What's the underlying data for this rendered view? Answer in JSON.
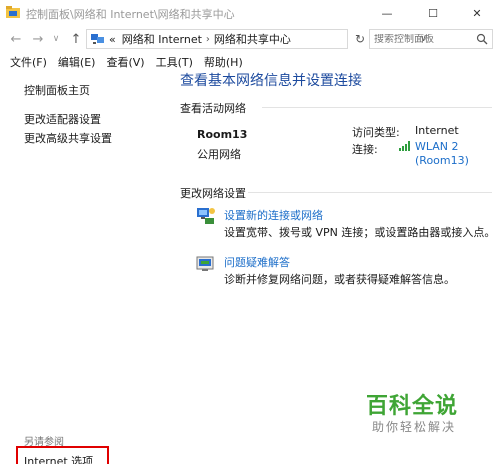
{
  "window": {
    "title": "控制面板\\网络和 Internet\\网络和共享中心",
    "minimize_glyph": "—",
    "maximize_glyph": "☐",
    "close_glyph": "✕"
  },
  "nav": {
    "back_glyph": "←",
    "forward_glyph": "→",
    "dropdown_glyph": "∨",
    "up_glyph": "↑",
    "refresh_glyph": "↻",
    "overflow": "«",
    "breadcrumb": [
      "网络和 Internet",
      "网络和共享中心"
    ],
    "breadcrumb_sep": "›",
    "chevron": "∨",
    "search_placeholder": "搜索控制面板"
  },
  "menu": {
    "items": [
      "文件(F)",
      "编辑(E)",
      "查看(V)",
      "工具(T)",
      "帮助(H)"
    ]
  },
  "sidebar": {
    "home": "控制面板主页",
    "adapter": "更改适配器设置",
    "sharing": "更改高级共享设置",
    "see_also": "另请参阅",
    "internet_options": "Internet 选项"
  },
  "main": {
    "title": "查看基本网络信息并设置连接",
    "active_section": "查看活动网络",
    "network_name": "Room13",
    "network_type": "公用网络",
    "access_type_label": "访问类型:",
    "access_type_value": "Internet",
    "connection_label": "连接:",
    "connection_line1": "WLAN 2",
    "connection_line2": "(Room13)",
    "change_section": "更改网络设置",
    "option1_link": "设置新的连接或网络",
    "option1_desc": "设置宽带、拨号或 VPN 连接；或设置路由器或接入点。",
    "option2_link": "问题疑难解答",
    "option2_desc": "诊断并修复网络问题，或者获得疑难解答信息。"
  },
  "watermark": {
    "title": "百科全说",
    "subtitle": "助你轻松解决"
  },
  "colors": {
    "link": "#1c6ec9",
    "title": "#1c4a9e",
    "highlight": "#e00000",
    "watermark": "#3fa535"
  }
}
